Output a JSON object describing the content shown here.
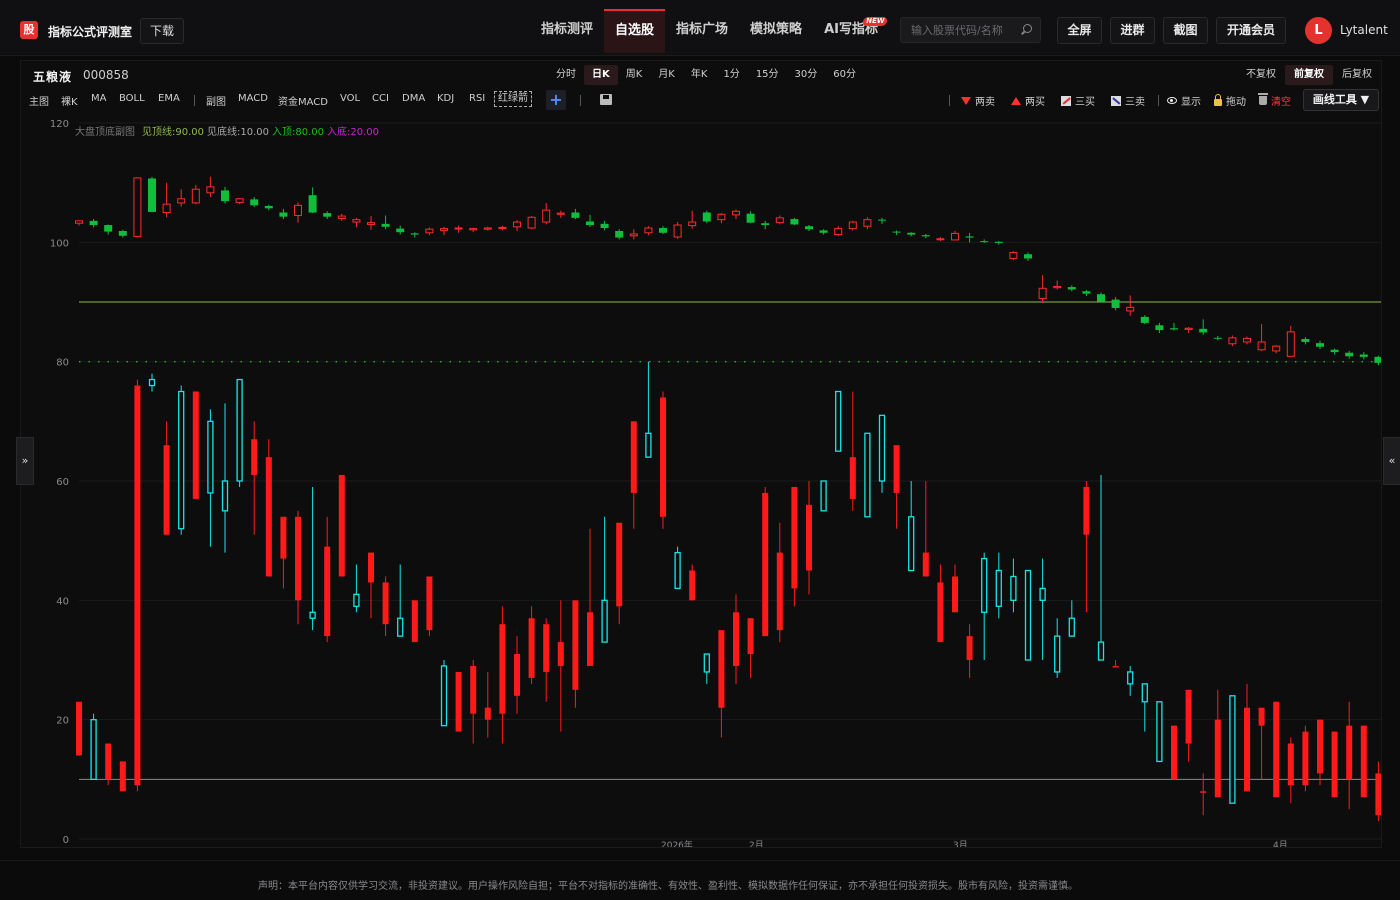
{
  "header": {
    "logo_glyph": "股",
    "title": "指标公式评测室",
    "download_label": "下载",
    "nav": [
      {
        "label": "指标测评",
        "active": false
      },
      {
        "label": "自选股",
        "active": true
      },
      {
        "label": "指标广场",
        "active": false
      },
      {
        "label": "模拟策略",
        "active": false
      },
      {
        "label": "AI写指标",
        "active": false,
        "badge": "NEW"
      }
    ],
    "search_placeholder": "输入股票代码/名称",
    "fullscreen_label": "全屏",
    "join_group_label": "进群",
    "screenshot_label": "截图",
    "vip_label": "开通会员",
    "avatar_letter": "L",
    "username": "Lytalent"
  },
  "stock": {
    "name": "五粮液",
    "code": "000858"
  },
  "periods": [
    "分时",
    "日K",
    "周K",
    "月K",
    "年K",
    "1分",
    "15分",
    "30分",
    "60分"
  ],
  "active_period": "日K",
  "adjust": [
    "不复权",
    "前复权",
    "后复权"
  ],
  "active_adjust": "前复权",
  "indicators_main": [
    "主图",
    "裸K",
    "MA",
    "BOLL",
    "EMA"
  ],
  "indicators_sub": [
    "副图",
    "MACD",
    "资金MACD",
    "VOL",
    "CCI",
    "DMA",
    "KDJ",
    "RSI"
  ],
  "indicator_selected": "红绿箭",
  "markers": {
    "two_sell": "两卖",
    "two_buy": "两买",
    "three_buy": "三买",
    "three_sell": "三卖",
    "show": "显示",
    "drag": "拖动",
    "clear": "清空"
  },
  "draw_tool_label": "画线工具 ▼",
  "colors": {
    "accent": "#e4332f",
    "up": "#ff2a2a",
    "down": "#0fbf3c",
    "osc_up": "#ff1a1a",
    "osc_down": "#16e6e6",
    "line_top": "#8fba4a",
    "line_bottom": "#8a8a8a",
    "line_buy": "#18c018"
  },
  "legend": {
    "name": "大盘顶底副图",
    "top_line": "见顶线:90.00",
    "bottom_line": "见底线:10.00",
    "enter_top": "入顶:80.00",
    "enter_bottom": "入底:20.00"
  },
  "chart_data": {
    "type": "candlestick",
    "ylim": [
      0,
      120
    ],
    "y_ticks": [
      0,
      20,
      40,
      60,
      80,
      100,
      120
    ],
    "x_labels": [
      "2026年",
      "2月",
      "3月",
      "4月"
    ],
    "reference_lines": {
      "top": 90,
      "bottom": 10,
      "enter_top": 80
    },
    "price_candles": [
      [
        103.2,
        103.6,
        102.8,
        103.3
      ],
      [
        103.6,
        102.9,
        102.5,
        103.9
      ],
      [
        102.9,
        101.8,
        101.3,
        103.0
      ],
      [
        101.9,
        101.1,
        100.8,
        102.1
      ],
      [
        101.0,
        110.8,
        101.0,
        110.9
      ],
      [
        110.7,
        105.1,
        105.0,
        111.0
      ],
      [
        105.0,
        106.4,
        104.2,
        110.0
      ],
      [
        106.6,
        107.3,
        106.0,
        108.9
      ],
      [
        106.6,
        108.9,
        106.4,
        109.6
      ],
      [
        108.3,
        109.3,
        107.6,
        111.0
      ],
      [
        108.7,
        106.9,
        106.5,
        109.3
      ],
      [
        106.7,
        107.3,
        106.4,
        107.4
      ],
      [
        107.2,
        106.2,
        105.9,
        107.6
      ],
      [
        106.1,
        105.7,
        105.4,
        106.3
      ],
      [
        105.0,
        104.3,
        103.9,
        105.6
      ],
      [
        104.5,
        106.2,
        103.3,
        106.7
      ],
      [
        107.9,
        105.0,
        104.9,
        109.2
      ],
      [
        104.9,
        104.3,
        103.9,
        105.2
      ],
      [
        104.0,
        104.4,
        103.6,
        104.8
      ],
      [
        103.4,
        103.8,
        102.5,
        104.1
      ],
      [
        103.0,
        103.3,
        102.1,
        104.4
      ],
      [
        103.1,
        102.6,
        102.2,
        104.5
      ],
      [
        102.3,
        101.7,
        101.3,
        102.8
      ],
      [
        101.5,
        101.3,
        100.8,
        101.7
      ],
      [
        101.6,
        102.2,
        101.2,
        102.5
      ],
      [
        102.0,
        102.3,
        101.2,
        102.6
      ],
      [
        102.4,
        102.4,
        101.6,
        102.8
      ],
      [
        102.1,
        102.3,
        101.7,
        102.4
      ],
      [
        102.2,
        102.4,
        102.0,
        102.6
      ],
      [
        102.5,
        102.5,
        102.0,
        102.8
      ],
      [
        102.6,
        103.4,
        101.9,
        103.7
      ],
      [
        102.4,
        104.2,
        102.2,
        104.4
      ],
      [
        103.4,
        105.4,
        103.0,
        106.6
      ],
      [
        104.7,
        104.9,
        104.1,
        105.3
      ],
      [
        105.0,
        104.1,
        103.9,
        105.6
      ],
      [
        103.5,
        102.9,
        102.6,
        104.6
      ],
      [
        103.1,
        102.4,
        102.0,
        103.6
      ],
      [
        101.9,
        100.8,
        100.5,
        102.2
      ],
      [
        101.1,
        101.4,
        100.5,
        102.2
      ],
      [
        101.6,
        102.4,
        101.2,
        102.7
      ],
      [
        102.4,
        101.6,
        101.4,
        102.7
      ],
      [
        100.9,
        102.9,
        100.6,
        103.4
      ],
      [
        102.8,
        103.4,
        102.3,
        105.3
      ],
      [
        105.0,
        103.5,
        103.2,
        105.3
      ],
      [
        103.8,
        104.7,
        103.2,
        104.9
      ],
      [
        104.6,
        105.2,
        103.9,
        105.5
      ],
      [
        104.8,
        103.3,
        103.2,
        105.2
      ],
      [
        103.2,
        102.9,
        102.2,
        103.6
      ],
      [
        103.3,
        104.1,
        103.0,
        104.5
      ],
      [
        103.9,
        103.0,
        102.9,
        104.1
      ],
      [
        102.7,
        102.2,
        101.9,
        102.9
      ],
      [
        102.0,
        101.6,
        101.3,
        102.2
      ],
      [
        101.3,
        102.3,
        101.1,
        102.7
      ],
      [
        102.3,
        103.4,
        102.0,
        103.6
      ],
      [
        102.7,
        103.8,
        102.2,
        104.2
      ],
      [
        103.8,
        103.7,
        103.1,
        104.1
      ],
      [
        101.8,
        101.7,
        101.2,
        102.0
      ],
      [
        101.6,
        101.3,
        101.0,
        101.7
      ],
      [
        101.2,
        101.0,
        100.7,
        101.4
      ],
      [
        100.5,
        100.6,
        100.2,
        100.9
      ],
      [
        100.4,
        101.5,
        100.3,
        101.9
      ],
      [
        101.0,
        100.8,
        100.0,
        101.6
      ],
      [
        100.2,
        100.1,
        99.9,
        100.5
      ],
      [
        100.1,
        99.9,
        99.6,
        100.2
      ],
      [
        97.3,
        98.3,
        97.0,
        98.5
      ],
      [
        98.0,
        97.3,
        96.9,
        98.3
      ],
      [
        90.6,
        92.3,
        89.8,
        94.5
      ],
      [
        92.4,
        92.6,
        92.1,
        93.6
      ],
      [
        92.5,
        92.1,
        91.8,
        92.8
      ],
      [
        91.8,
        91.4,
        91.0,
        92.0
      ],
      [
        91.3,
        90.1,
        89.9,
        91.6
      ],
      [
        90.4,
        89.0,
        88.6,
        90.8
      ],
      [
        88.5,
        89.1,
        87.7,
        91.1
      ],
      [
        87.5,
        86.5,
        86.3,
        87.8
      ],
      [
        86.1,
        85.3,
        84.8,
        86.5
      ],
      [
        85.6,
        85.4,
        85.2,
        86.5
      ],
      [
        85.4,
        85.6,
        84.8,
        85.8
      ],
      [
        85.5,
        84.9,
        84.5,
        87.1
      ],
      [
        84.0,
        83.9,
        83.6,
        84.3
      ],
      [
        83.0,
        84.0,
        82.6,
        84.4
      ],
      [
        83.3,
        83.9,
        82.9,
        84.2
      ],
      [
        82.0,
        83.3,
        81.8,
        86.3
      ],
      [
        81.8,
        82.6,
        81.4,
        82.8
      ],
      [
        80.9,
        85.0,
        80.9,
        86.0
      ],
      [
        83.8,
        83.3,
        82.9,
        84.1
      ],
      [
        83.1,
        82.5,
        82.1,
        83.5
      ],
      [
        82.0,
        81.6,
        81.2,
        82.2
      ],
      [
        81.5,
        80.9,
        80.5,
        81.8
      ],
      [
        81.2,
        80.8,
        80.4,
        81.6
      ],
      [
        80.8,
        79.8,
        79.4,
        81.0
      ],
      [
        79.6,
        79.0,
        78.6,
        79.8
      ],
      [
        79.0,
        79.3,
        78.5,
        79.7
      ],
      [
        78.6,
        78.1,
        77.8,
        79.5
      ]
    ],
    "osc_bars": [
      [
        14,
        23,
        14,
        23
      ],
      [
        20,
        10,
        10,
        21
      ],
      [
        10,
        16,
        9,
        16
      ],
      [
        8,
        13,
        8,
        13
      ],
      [
        9,
        76,
        8,
        77
      ],
      [
        77,
        76,
        75,
        78
      ],
      [
        51,
        66,
        51,
        70
      ],
      [
        75,
        52,
        51,
        76
      ],
      [
        57,
        75,
        57,
        75
      ],
      [
        70,
        58,
        49,
        72
      ],
      [
        60,
        55,
        48,
        73
      ],
      [
        77,
        60,
        59,
        77
      ],
      [
        61,
        67,
        51,
        70
      ],
      [
        44,
        64,
        44,
        67
      ],
      [
        47,
        54,
        42,
        54
      ],
      [
        40,
        54,
        36,
        55
      ],
      [
        38,
        37,
        35,
        59
      ],
      [
        34,
        49,
        33,
        54
      ],
      [
        44,
        61,
        44,
        61
      ],
      [
        41,
        39,
        38,
        46
      ],
      [
        43,
        48,
        37,
        48
      ],
      [
        36,
        43,
        34,
        44
      ],
      [
        37,
        34,
        34,
        46
      ],
      [
        33,
        40,
        33,
        40
      ],
      [
        35,
        44,
        34,
        44
      ],
      [
        29,
        19,
        20,
        30
      ],
      [
        18,
        28,
        18,
        28
      ],
      [
        21,
        29,
        16,
        30
      ],
      [
        20,
        22,
        17,
        28
      ],
      [
        21,
        36,
        16,
        39
      ],
      [
        24,
        31,
        21,
        34
      ],
      [
        27,
        37,
        26,
        39
      ],
      [
        28,
        36,
        23,
        37
      ],
      [
        29,
        33,
        18,
        40
      ],
      [
        25,
        40,
        22,
        40
      ],
      [
        29,
        38,
        33,
        52
      ],
      [
        40,
        33,
        35,
        54
      ],
      [
        39,
        53,
        36,
        53
      ],
      [
        58,
        70,
        52,
        70
      ],
      [
        68,
        64,
        74,
        80
      ],
      [
        54,
        74,
        52,
        75
      ],
      [
        48,
        42,
        42,
        49
      ],
      [
        40,
        45,
        40,
        46
      ],
      [
        31,
        28,
        26,
        30
      ],
      [
        22,
        35,
        17,
        35
      ],
      [
        29,
        38,
        26,
        41
      ],
      [
        31,
        37,
        27,
        36
      ],
      [
        34,
        58,
        34,
        59
      ],
      [
        35,
        48,
        33,
        53
      ],
      [
        42,
        59,
        39,
        59
      ],
      [
        45,
        56,
        41,
        60
      ],
      [
        60,
        55,
        57,
        60
      ],
      [
        75,
        65,
        65,
        75
      ],
      [
        57,
        64,
        55,
        75
      ],
      [
        68,
        54,
        54,
        68
      ],
      [
        71,
        60,
        58,
        71
      ],
      [
        58,
        66,
        52,
        66
      ],
      [
        54,
        45,
        45,
        60
      ],
      [
        44,
        48,
        44,
        60
      ],
      [
        33,
        43,
        33,
        46
      ],
      [
        38,
        44,
        38,
        46
      ],
      [
        30,
        34,
        27,
        36
      ],
      [
        47,
        38,
        30,
        48
      ],
      [
        45,
        39,
        37,
        48
      ],
      [
        44,
        40,
        38,
        47
      ],
      [
        45,
        30,
        31,
        40
      ],
      [
        42,
        40,
        30,
        47
      ],
      [
        34,
        28,
        27,
        37
      ],
      [
        37,
        34,
        35,
        40
      ],
      [
        51,
        59,
        38,
        60
      ],
      [
        33,
        30,
        35,
        61
      ],
      [
        29,
        29,
        29,
        30
      ],
      [
        28,
        26,
        24,
        29
      ],
      [
        26,
        23,
        18,
        23
      ],
      [
        23,
        13,
        13,
        23
      ],
      [
        10,
        19,
        10,
        19
      ],
      [
        16,
        25,
        13,
        25
      ],
      [
        8,
        8,
        4,
        11
      ],
      [
        7,
        20,
        7,
        25
      ],
      [
        24,
        6,
        6,
        24
      ],
      [
        8,
        22,
        8,
        26
      ],
      [
        19,
        22,
        10,
        22
      ],
      [
        7,
        23,
        7,
        23
      ],
      [
        9,
        16,
        6,
        17
      ],
      [
        9,
        18,
        8,
        19
      ],
      [
        11,
        20,
        9,
        20
      ],
      [
        7,
        18,
        7,
        18
      ],
      [
        10,
        19,
        5,
        23
      ],
      [
        7,
        19,
        7,
        19
      ],
      [
        4,
        11,
        3,
        13
      ],
      [
        6,
        17,
        6,
        17
      ],
      [
        26,
        21,
        25,
        25
      ],
      [
        15,
        17,
        15,
        22
      ],
      [
        20,
        11,
        5,
        27
      ],
      [
        9,
        25,
        5,
        25
      ],
      [
        7,
        16,
        4,
        17
      ]
    ]
  },
  "disclaimer": "声明：本平台内容仅供学习交流，非投资建议。用户操作风险自担；平台不对指标的准确性、有效性、盈利性、模拟数据作任何保证，亦不承担任何投资损失。股市有风险，投资需谨慎。"
}
